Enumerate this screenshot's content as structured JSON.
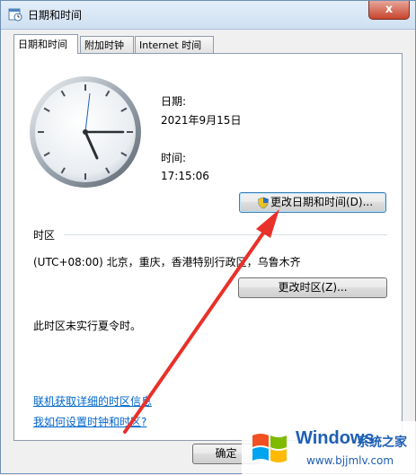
{
  "window": {
    "title": "日期和时间",
    "close_label": "x"
  },
  "tabs": [
    {
      "label": "日期和时间",
      "selected": true
    },
    {
      "label": "附加时钟",
      "selected": false
    },
    {
      "label": "Internet 时间",
      "selected": false
    }
  ],
  "date_time": {
    "date_label": "日期:",
    "date_value": "2021年9月15日",
    "time_label": "时间:",
    "time_value": "17:15:06",
    "change_datetime_button": "更改日期和时间(D)..."
  },
  "timezone": {
    "section_label": "时区",
    "current_value": "(UTC+08:00) 北京，重庆，香港特别行政区，乌鲁木齐",
    "change_timezone_button": "更改时区(Z)...",
    "dst_note": "此时区未实行夏令时。"
  },
  "links": {
    "timezone_info": "联机获取详细的时区信息",
    "how_to_set": "我如何设置时钟和时区?"
  },
  "footer": {
    "ok_button": "确定"
  },
  "watermark": {
    "brand": "Windows",
    "cn": "系统之家",
    "url": "www.bjjmlv.com"
  },
  "colors": {
    "arrow": "#e8312a",
    "link": "#0066cc",
    "watermark": "#1d5fb4"
  }
}
